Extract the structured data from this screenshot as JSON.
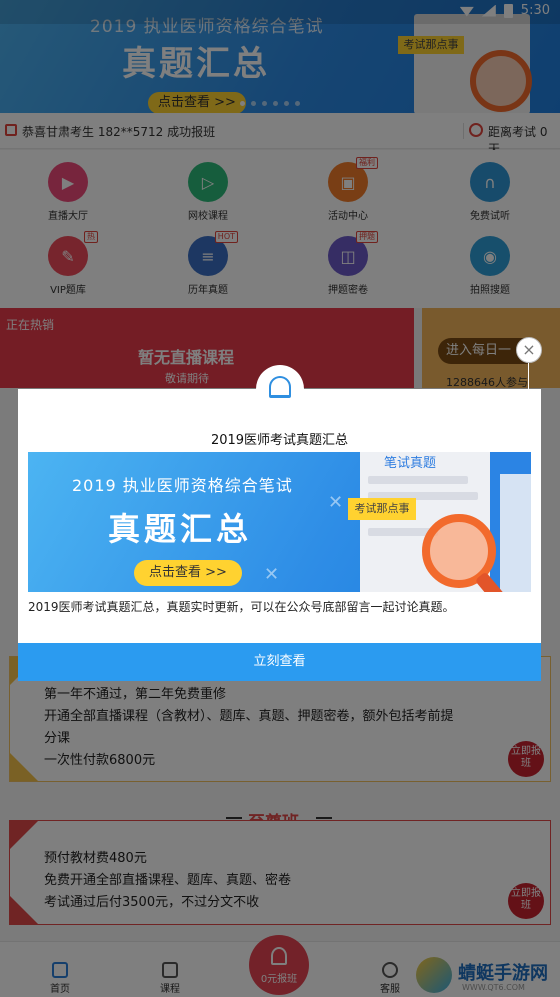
{
  "status_bar": {
    "time": "5:30"
  },
  "banner": {
    "line1": "2019 执业医师资格综合笔试",
    "line2": "真题汇总",
    "button": "点击查看 >>",
    "tag": "考试那点事"
  },
  "notice": {
    "message": "恭喜甘肃考生 182**5712 成功报班",
    "countdown": "距离考试 0 天"
  },
  "grid": {
    "items": [
      {
        "label": "直播大厅",
        "badge": ""
      },
      {
        "label": "网校课程",
        "badge": ""
      },
      {
        "label": "活动中心",
        "badge": "福利"
      },
      {
        "label": "免费试听",
        "badge": ""
      },
      {
        "label": "VIP题库",
        "badge": "热"
      },
      {
        "label": "历年真题",
        "badge": "HOT"
      },
      {
        "label": "押题密卷",
        "badge": "押题"
      },
      {
        "label": "拍照搜题",
        "badge": ""
      }
    ]
  },
  "promo": {
    "left_tag": "正在热销",
    "left_title": "暂无直播课程",
    "left_sub": "敬请期待",
    "right_pill": "进入每日一",
    "right_count": "1288646人参与"
  },
  "course_card_1": {
    "lines": [
      "第一年不通过，第二年免费重修",
      "开通全部直播课程（含教材）、题库、真题、押题密卷，额外包括考前提",
      "分课",
      "一次性付款6800元"
    ],
    "cta": "立即报班"
  },
  "course_card_2": {
    "title": "至尊班",
    "lines": [
      "预付教材费480元",
      "免费开通全部直播课程、题库、真题、密卷",
      "考试通过后付3500元，不过分文不收"
    ],
    "cta": "立即报班"
  },
  "nav": {
    "home": "首页",
    "course": "课程",
    "center": "0元报班",
    "service": "客服"
  },
  "watermark": {
    "title": "蜻蜓手游网",
    "sub": "WWW.QT6.COM"
  },
  "dialog": {
    "title": "2019医师考试真题汇总",
    "image": {
      "line1": "2019 执业医师资格综合笔试",
      "line2": "真题汇总",
      "button": "点击查看 >>",
      "paper_title": "笔试真题",
      "tag": "考试那点事"
    },
    "description": "2019医师考试真题汇总，真题实时更新，可以在公众号底部留言一起讨论真题。",
    "action": "立刻查看",
    "close_glyph": "×"
  },
  "colors": {
    "accent_blue": "#2b9bf0",
    "promo_red": "#e83a4a",
    "cta_red": "#c8232f",
    "gold": "#f4c24a"
  }
}
